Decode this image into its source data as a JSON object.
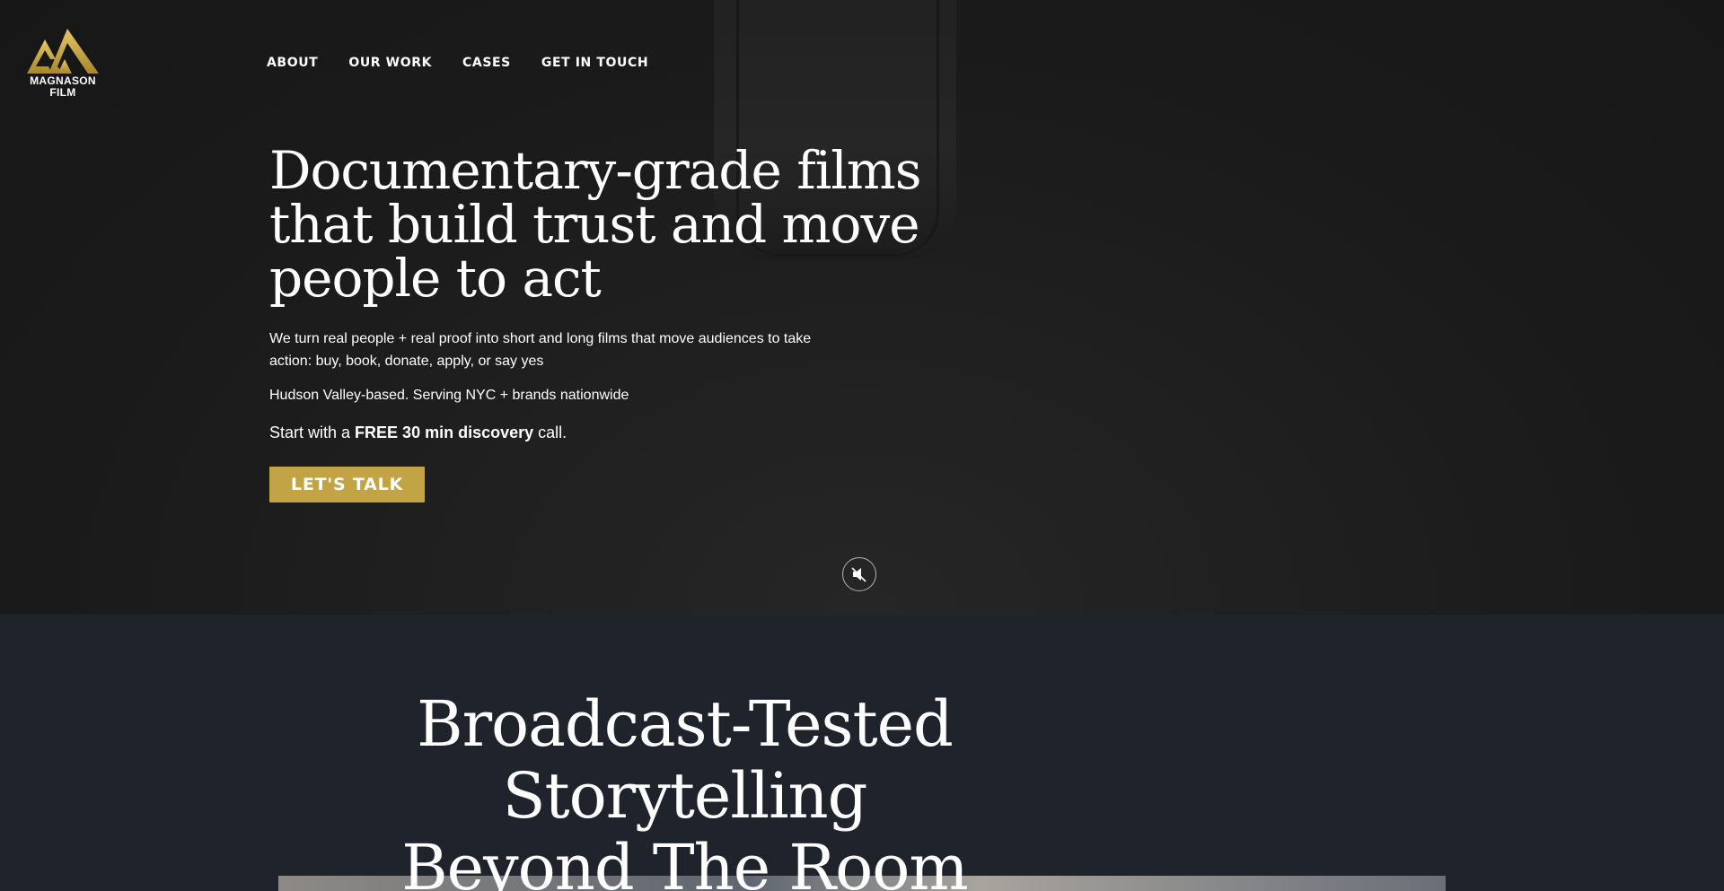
{
  "brand": {
    "logo_line1": "MAGNASON",
    "logo_line2": "FILM",
    "accent_color": "#c3a444"
  },
  "nav": {
    "items": [
      {
        "label": "ABOUT"
      },
      {
        "label": "OUR WORK"
      },
      {
        "label": "CASES"
      },
      {
        "label": "GET IN TOUCH"
      }
    ]
  },
  "hero": {
    "headline": "Documentary-grade films that build trust and move people to act",
    "subtext": "We turn real people + real proof into short and long films that move audiences to take action: buy, book, donate, apply, or say yes",
    "location": "Hudson Valley-based. Serving NYC + brands nationwide",
    "cta_prefix": "Start with a ",
    "cta_bold": "FREE 30 min discovery",
    "cta_suffix": " call.",
    "button_label": "LET'S TALK",
    "mute_icon": "speaker-muted-icon"
  },
  "section2": {
    "title_line1": "Broadcast-Tested",
    "title_line2": "Storytelling",
    "title_line3": "Beyond The Room"
  }
}
